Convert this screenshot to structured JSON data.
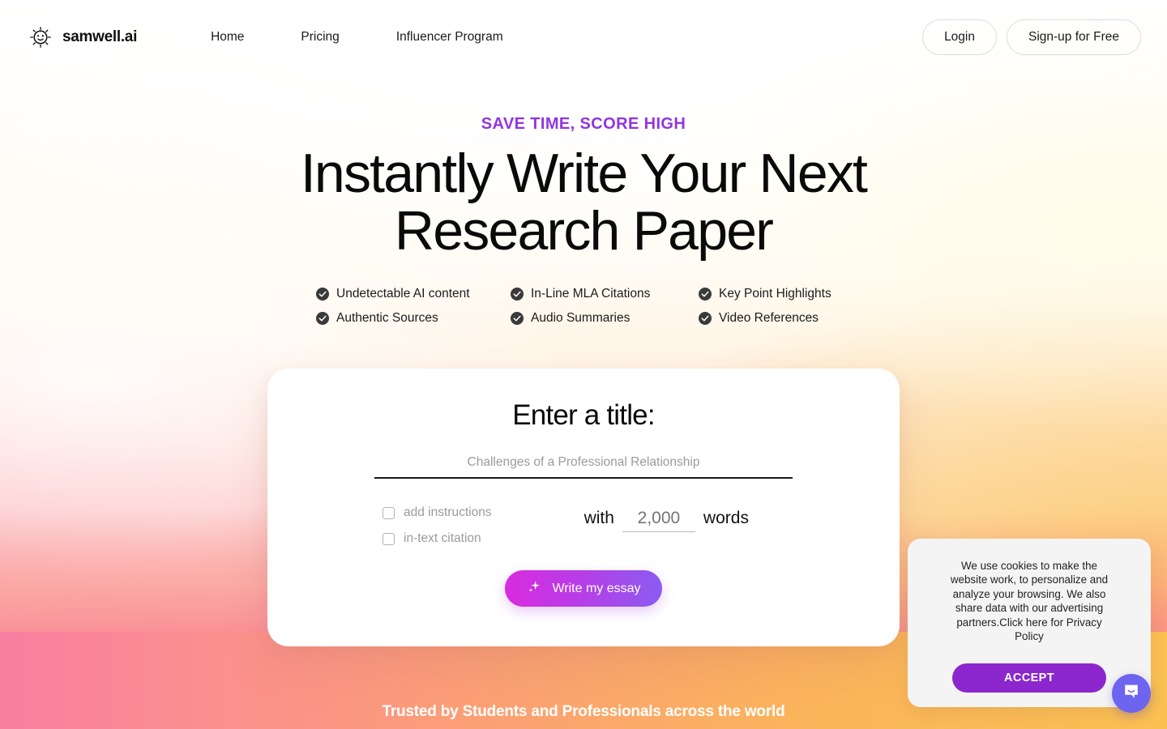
{
  "header": {
    "brand_name": "samwell.ai",
    "logo_icon": "sun-smiley-icon",
    "nav": [
      {
        "label": "Home"
      },
      {
        "label": "Pricing"
      },
      {
        "label": "Influencer Program"
      }
    ],
    "login_label": "Login",
    "signup_label": "Sign-up for Free"
  },
  "hero": {
    "eyebrow": "SAVE TIME, SCORE HIGH",
    "eyebrow_color": "#9135e0",
    "headline": "Instantly Write Your Next Research Paper",
    "features": [
      {
        "label": "Undetectable AI content",
        "icon": "check-circle-icon"
      },
      {
        "label": "In-Line MLA Citations",
        "icon": "check-circle-icon"
      },
      {
        "label": "Key Point Highlights",
        "icon": "check-circle-icon"
      },
      {
        "label": "Authentic Sources",
        "icon": "check-circle-icon"
      },
      {
        "label": "Audio Summaries",
        "icon": "check-circle-icon"
      },
      {
        "label": "Video References",
        "icon": "check-circle-icon"
      }
    ]
  },
  "card": {
    "title": "Enter a title:",
    "title_input": {
      "value": "",
      "placeholder": "Challenges of a Professional Relationship"
    },
    "checkboxes": [
      {
        "label": "add instructions",
        "checked": false
      },
      {
        "label": "in-text citation",
        "checked": false
      }
    ],
    "word_count": {
      "prefix": "with",
      "value": "",
      "placeholder": "2,000",
      "suffix": "words"
    },
    "cta": {
      "label": "Write my essay",
      "icon": "sparkle-icon",
      "gradient_from": "#d92be0",
      "gradient_to": "#8b5cf0"
    }
  },
  "trusted": {
    "text": "Trusted by Students and Professionals across the world"
  },
  "cookie_banner": {
    "text": "We use cookies to make the website work, to personalize and analyze your browsing. We also share data with our advertising partners.Click here for Privacy Policy",
    "accept_label": "ACCEPT",
    "accept_color": "#8b27cc"
  },
  "chat_widget": {
    "icon": "chat-bubble-smile-icon",
    "color": "#6d64f0"
  }
}
